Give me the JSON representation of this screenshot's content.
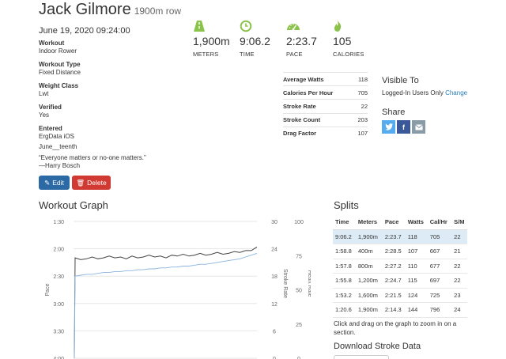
{
  "header": {
    "name": "Jack Gilmore",
    "subtitle": "1900m row",
    "date": "June 19, 2020 09:24:00"
  },
  "meta": [
    {
      "label": "Workout",
      "value": "Indoor Rower"
    },
    {
      "label": "Workout Type",
      "value": "Fixed Distance"
    },
    {
      "label": "Weight Class",
      "value": "Lwt"
    },
    {
      "label": "Verified",
      "value": "Yes"
    },
    {
      "label": "Entered",
      "value": "ErgData iOS"
    }
  ],
  "notes": {
    "title": "June__teenth",
    "quote": "“Everyone matters or no-one matters.”",
    "author": "—Harry Bosch"
  },
  "buttons": {
    "edit": "Edit",
    "delete": "Delete"
  },
  "stats": [
    {
      "icon": "road-icon",
      "value": "1,900m",
      "unit": "METERS"
    },
    {
      "icon": "clock-icon",
      "value": "9:06.2",
      "unit": "TIME"
    },
    {
      "icon": "speedometer-icon",
      "value": "2:23.7",
      "unit": "PACE"
    },
    {
      "icon": "flame-icon",
      "value": "105",
      "unit": "CALORIES"
    }
  ],
  "metrics": [
    {
      "label": "Average Watts",
      "value": "118"
    },
    {
      "label": "Calories Per Hour",
      "value": "705"
    },
    {
      "label": "Stroke Rate",
      "value": "22"
    },
    {
      "label": "Stroke Count",
      "value": "203"
    },
    {
      "label": "Drag Factor",
      "value": "107"
    }
  ],
  "visibility": {
    "heading": "Visible To",
    "value": "Logged-In Users Only",
    "change": "Change"
  },
  "share": {
    "heading": "Share"
  },
  "colors": {
    "accent": "#8bc34a",
    "primary": "#2c6aa6",
    "danger": "#d03a33",
    "twitter": "#55acee",
    "facebook": "#3b5998",
    "email": "#8a9ba8",
    "highlight": "#dcebf5"
  },
  "graph": {
    "heading": "Workout Graph"
  },
  "chart_data": {
    "type": "line",
    "left_axis": {
      "label": "Pace",
      "ticks": [
        "1:30",
        "2:00",
        "2:30",
        "3:00",
        "3:30",
        "4:00"
      ],
      "range_sec": [
        90,
        240
      ],
      "inverted": true
    },
    "right_axes": [
      {
        "label": "Stroke Rate",
        "ticks": [
          "30",
          "24",
          "18",
          "12",
          "6",
          "0"
        ],
        "range": [
          0,
          30
        ]
      },
      {
        "label": "Heart Rate",
        "ticks": [
          "100",
          "75",
          "50",
          "25",
          "0"
        ],
        "range": [
          0,
          100
        ]
      }
    ],
    "series": [
      {
        "color": "#444444",
        "pace_sec": [
          240,
          130,
          132,
          131,
          129,
          131,
          130,
          128,
          130,
          129,
          131,
          128,
          130,
          129,
          127,
          129,
          128,
          130,
          127,
          128,
          126,
          128,
          127,
          125,
          127,
          126,
          124,
          126,
          125,
          123,
          124,
          122,
          122,
          118
        ]
      },
      {
        "color": "#8ab4dd",
        "pace_sec": [
          240,
          150,
          149,
          148,
          148,
          147,
          146,
          146,
          145,
          145,
          144,
          144,
          143,
          143,
          142,
          142,
          141,
          141,
          140,
          140,
          139,
          139,
          138,
          137,
          137,
          136,
          135,
          134,
          133,
          132,
          131,
          129,
          127,
          125
        ]
      }
    ]
  },
  "splits": {
    "heading": "Splits",
    "columns": [
      "Time",
      "Meters",
      "Pace",
      "Watts",
      "Cal/Hr",
      "S/M"
    ],
    "rows": [
      [
        "9:06.2",
        "1,900m",
        "2:23.7",
        "118",
        "705",
        "22"
      ],
      [
        "1:58.8",
        "400m",
        "2:28.5",
        "107",
        "667",
        "21"
      ],
      [
        "1:57.8",
        "800m",
        "2:27.2",
        "110",
        "677",
        "22"
      ],
      [
        "1:55.8",
        "1,200m",
        "2:24.7",
        "115",
        "697",
        "22"
      ],
      [
        "1:53.2",
        "1,600m",
        "2:21.5",
        "124",
        "725",
        "23"
      ],
      [
        "1:20.6",
        "1,900m",
        "2:14.3",
        "144",
        "796",
        "24"
      ]
    ],
    "hint": "Click and drag on the graph to zoom in on a section.",
    "download": "Download Stroke Data"
  }
}
